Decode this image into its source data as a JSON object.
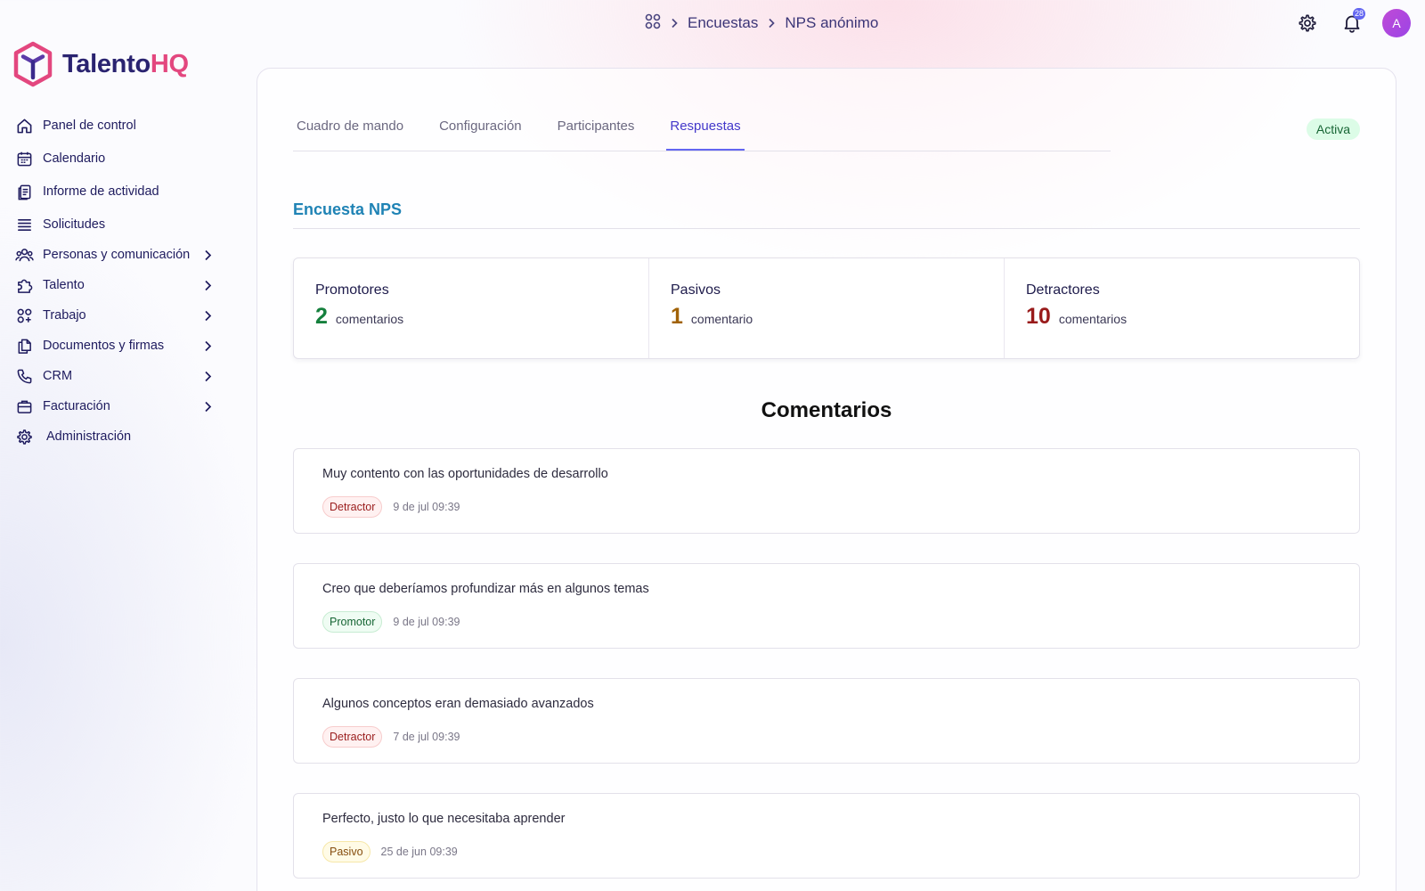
{
  "breadcrumb": {
    "items": [
      "Encuestas",
      "NPS anónimo"
    ]
  },
  "header": {
    "notification_count": "28",
    "avatar_initial": "A"
  },
  "brand": {
    "name_part1": "Talento",
    "name_part2": "HQ"
  },
  "sidebar": {
    "items": [
      {
        "label": "Panel de control",
        "icon": "home-icon"
      },
      {
        "label": "Calendario",
        "icon": "calendar-icon"
      },
      {
        "label": "Informe de actividad",
        "icon": "clipboard-icon"
      },
      {
        "label": "Solicitudes",
        "icon": "list-icon"
      },
      {
        "label": "Personas y comunicación",
        "icon": "people-icon"
      },
      {
        "label": "Talento",
        "icon": "puzzle-icon"
      },
      {
        "label": "Trabajo",
        "icon": "grid-icon"
      },
      {
        "label": "Documentos y firmas",
        "icon": "documents-icon"
      },
      {
        "label": "CRM",
        "icon": "phone-icon"
      },
      {
        "label": "Facturación",
        "icon": "briefcase-icon"
      },
      {
        "label": "Administración",
        "icon": "gear-icon"
      }
    ]
  },
  "tabs": [
    {
      "label": "Cuadro de mando"
    },
    {
      "label": "Configuración"
    },
    {
      "label": "Participantes"
    },
    {
      "label": "Respuestas"
    }
  ],
  "status": "Activa",
  "survey": {
    "title": "Encuesta NPS"
  },
  "stats": [
    {
      "label": "Promotores",
      "count": "2",
      "unit": "comentarios",
      "color": "#15803d"
    },
    {
      "label": "Pasivos",
      "count": "1",
      "unit": "comentario",
      "color": "#a16207"
    },
    {
      "label": "Detractores",
      "count": "10",
      "unit": "comentarios",
      "color": "#991b1b"
    }
  ],
  "comments_title": "Comentarios",
  "comments": [
    {
      "text": "Muy contento con las oportunidades de desarrollo",
      "tag": "Detractor",
      "date": "9 de jul 09:39"
    },
    {
      "text": "Creo que deberíamos profundizar más en algunos temas",
      "tag": "Promotor",
      "date": "9 de jul 09:39"
    },
    {
      "text": "Algunos conceptos eran demasiado avanzados",
      "tag": "Detractor",
      "date": "7 de jul 09:39"
    },
    {
      "text": "Perfecto, justo lo que necesitaba aprender",
      "tag": "Pasivo",
      "date": "25 de jun 09:39"
    }
  ],
  "colors": {
    "accent": "#6366f1",
    "brand_dark": "#2a2370",
    "brand_pink": "#e3477f",
    "title_blue": "#1f83b5"
  }
}
